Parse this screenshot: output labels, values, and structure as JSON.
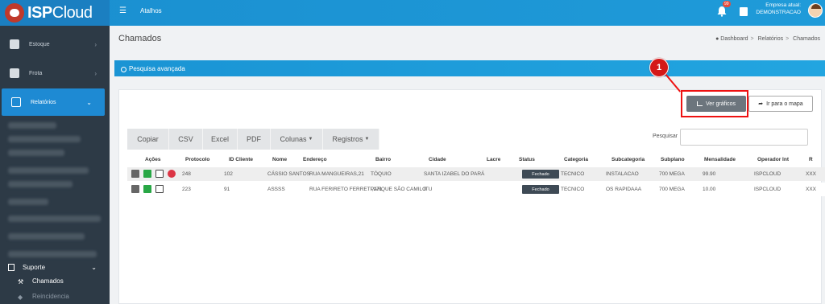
{
  "header": {
    "logo_bold": "ISP",
    "logo_light": "Cloud",
    "atalhos": "Atalhos",
    "notifications_count": "99",
    "empresa_label": "Empresa atual:",
    "empresa_value": "DEMONSTRACAO"
  },
  "sidebar": {
    "items": [
      {
        "label": "Estoque"
      },
      {
        "label": "Frota"
      },
      {
        "label": "Relatórios"
      }
    ],
    "suporte": "Suporte",
    "sub_items": [
      {
        "label": "Chamados"
      },
      {
        "label": "Reincidencia"
      }
    ]
  },
  "page": {
    "title": "Chamados",
    "breadcrumb": [
      "Dashboard",
      "Relatórios",
      "Chamados"
    ]
  },
  "search_bar": {
    "label": "Pesquisa avançada"
  },
  "buttons": {
    "ver_graficos": "Ver gráficos",
    "ir_para_mapa": "Ir para o mapa",
    "callout_number": "1"
  },
  "datatable_buttons": [
    "Copiar",
    "CSV",
    "Excel",
    "PDF",
    "Colunas",
    "Registros"
  ],
  "search": {
    "label": "Pesquisar"
  },
  "table": {
    "columns": [
      "Ações",
      "Protocolo",
      "ID Cliente",
      "Nome",
      "Endereço",
      "Bairro",
      "Cidade",
      "Lacre",
      "Status",
      "Categoria",
      "Subcategoria",
      "Subplano",
      "Mensalidade",
      "Operador Int",
      "R"
    ],
    "rows": [
      {
        "protocolo": "248",
        "id_cliente": "102",
        "nome": "CÁSSIO SANTOS",
        "endereco": "RUA MANGUEIRAS,21",
        "bairro": "TÓQUIO",
        "cidade": "SANTA IZABEL DO PARÁ",
        "lacre": "",
        "status": "Fechado",
        "categoria": "TECNICO",
        "subcategoria": "INSTALACAO",
        "subplano": "700 MEGA",
        "mensalidade": "99.90",
        "operador": "ISPCLOUD",
        "r": "XXX"
      },
      {
        "protocolo": "223",
        "id_cliente": "91",
        "nome": "ASSSS",
        "endereco": "RUA FERIRETO FERRETI,171",
        "bairro": "PARQUE SÃO CAMILO",
        "cidade": "ITU",
        "lacre": "",
        "status": "Fechado",
        "categoria": "TECNICO",
        "subcategoria": "OS RAPIDAAA",
        "subplano": "700 MEGA",
        "mensalidade": "10.00",
        "operador": "ISPCLOUD",
        "r": "XXX"
      }
    ]
  }
}
